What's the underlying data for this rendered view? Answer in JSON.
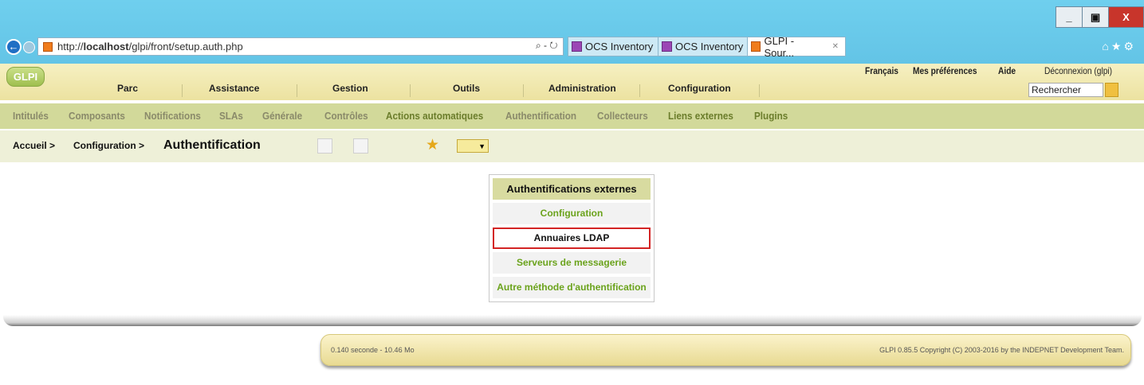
{
  "browser": {
    "url_prefix": "http://",
    "url_host": "localhost",
    "url_path": "/glpi/front/setup.auth.php",
    "address_tools": "⌕ - ↻",
    "tabs": [
      {
        "label": "OCS Inventory"
      },
      {
        "label": "OCS Inventory"
      },
      {
        "label": "GLPI - Sour...",
        "active": true
      }
    ],
    "window_controls": {
      "minimize": "_",
      "restore": "▣",
      "close": "X"
    },
    "icons": [
      "home-icon",
      "star-icon",
      "gear-icon"
    ]
  },
  "glpi": {
    "logo": "GLPI",
    "preferences": {
      "language": "Français",
      "my_prefs": "Mes préférences",
      "help": "Aide",
      "logout": "Déconnexion (glpi)"
    },
    "main_menu": [
      "Parc",
      "Assistance",
      "Gestion",
      "Outils",
      "Administration",
      "Configuration"
    ],
    "search_placeholder": "Rechercher",
    "sub_menu": [
      {
        "label": "Intitulés"
      },
      {
        "label": "Composants"
      },
      {
        "label": "Notifications"
      },
      {
        "label": "SLAs"
      },
      {
        "label": "Générale"
      },
      {
        "label": "Contrôles"
      },
      {
        "label": "Actions automatiques"
      },
      {
        "label": "Authentification"
      },
      {
        "label": "Collecteurs"
      },
      {
        "label": "Liens externes"
      },
      {
        "label": "Plugins"
      }
    ],
    "breadcrumb": {
      "home": "Accueil >",
      "config": "Configuration >",
      "current": "Authentification"
    }
  },
  "auth_menu": {
    "title": "Authentifications externes",
    "items": [
      {
        "label": "Configuration"
      },
      {
        "label": "Annuaires LDAP",
        "selected": true
      },
      {
        "label": "Serveurs de messagerie"
      },
      {
        "label": "Autre méthode d'authentification"
      }
    ]
  },
  "footer": {
    "timing": "0.140 seconde - 10.46 Mo",
    "copyright": "GLPI 0.85.5 Copyright (C) 2003-2016 by the INDEPNET Development Team."
  },
  "colors": {
    "browser_bar": "#6fcfee",
    "header": "#f6f0c2",
    "submenu": "#d2d99a",
    "link_green": "#6ba31c",
    "highlight_red": "#d32424"
  }
}
